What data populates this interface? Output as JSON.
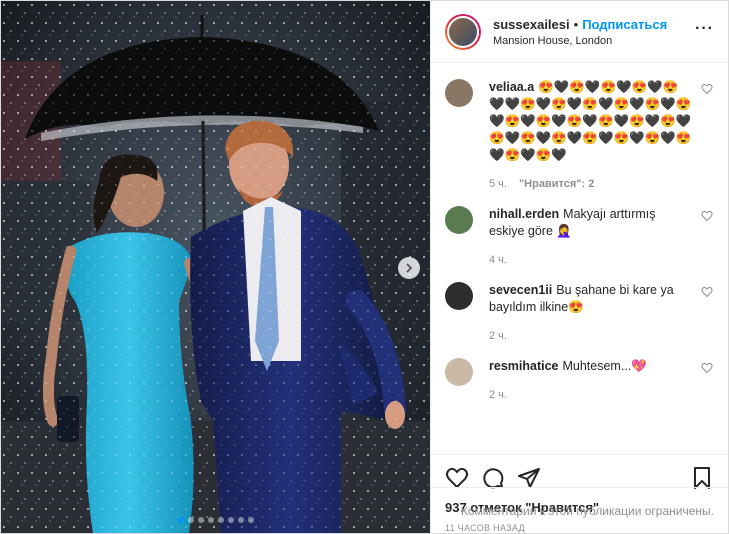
{
  "post": {
    "image_description": "",
    "carousel": {
      "dot_count": 8,
      "active_index": 0
    },
    "header": {
      "username": "sussexailesi",
      "separator": "•",
      "follow_label": "Подписаться",
      "location": "Mansion House, London",
      "more_icon": "more-horizontal-icon"
    },
    "comments": [
      {
        "username": "veliaa.a",
        "text": "😍🖤😍🖤😍🖤😍🖤😍🖤🖤😍🖤😍🖤😍🖤😍🖤😍🖤😍🖤😍🖤😍🖤😍🖤😍🖤😍🖤😍🖤😍🖤😍🖤😍🖤😍🖤😍🖤😍🖤😍🖤😍🖤😍🖤",
        "time": "5 ч.",
        "likes": "\"Нравится\": 2",
        "avatar_color": "#8a7664"
      },
      {
        "username": "nihall.erden",
        "text": "Makyajı arttırmış eskiye göre 🤦‍♀️",
        "time": "4 ч.",
        "likes": "",
        "avatar_color": "#5a7a52"
      },
      {
        "username": "sevecen1ii",
        "text": "Bu şahane bi kare ya bayıldım ilkine😍",
        "time": "2 ч.",
        "likes": "",
        "avatar_color": "#2e2e2e"
      },
      {
        "username": "resmihatice",
        "text": "Muhtesem...💖",
        "time": "2 ч.",
        "likes": "",
        "avatar_color": "#c9b9a6"
      }
    ],
    "actions": {
      "like_icon": "heart-icon",
      "comment_icon": "comment-icon",
      "share_icon": "share-icon",
      "save_icon": "bookmark-icon"
    },
    "likes_count": "937 отметок \"Нравится\"",
    "time_ago": "11 ЧАСОВ НАЗАД",
    "comments_restricted": "Комментарии к этой публикации ограничены."
  }
}
